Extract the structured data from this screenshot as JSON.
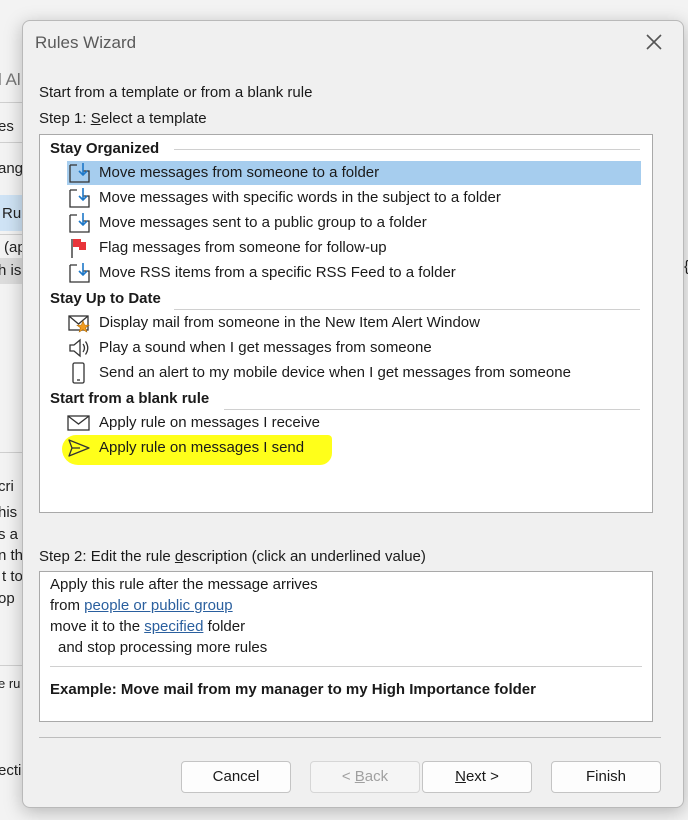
{
  "background": {
    "frag1": "l Al",
    "frag2": "es",
    "frag3": "ang",
    "frag4": "Rul",
    "frag5": "(ap",
    "frag6": "h is",
    "frag7": "cri",
    "frag8": "his",
    "frag9": "s a",
    "frag10": "n th",
    "frag11": "t to",
    "frag12": "op",
    "frag13": "e ru",
    "frag14": "ecti"
  },
  "dialog": {
    "title": "Rules Wizard",
    "intro": "Start from a template or from a blank rule",
    "step1": {
      "prefix": "Step 1: ",
      "accel": "S",
      "rest": "elect a template"
    },
    "groups": [
      {
        "header": "Stay Organized",
        "items": [
          {
            "label": "Move messages from someone to a folder",
            "icon": "move-folder-icon",
            "selected": true
          },
          {
            "label": "Move messages with specific words in the subject to a folder",
            "icon": "move-folder-icon",
            "selected": false
          },
          {
            "label": "Move messages sent to a public group to a folder",
            "icon": "move-folder-icon",
            "selected": false
          },
          {
            "label": "Flag messages from someone for follow-up",
            "icon": "flag-icon",
            "selected": false
          },
          {
            "label": "Move RSS items from a specific RSS Feed to a folder",
            "icon": "move-folder-icon",
            "selected": false
          }
        ]
      },
      {
        "header": "Stay Up to Date",
        "items": [
          {
            "label": "Display mail from someone in the New Item Alert Window",
            "icon": "mail-alert-icon",
            "selected": false
          },
          {
            "label": "Play a sound when I get messages from someone",
            "icon": "speaker-icon",
            "selected": false
          },
          {
            "label": "Send an alert to my mobile device when I get messages from someone",
            "icon": "mobile-device-icon",
            "selected": false
          }
        ]
      },
      {
        "header": "Start from a blank rule",
        "items": [
          {
            "label": "Apply rule on messages I receive",
            "icon": "envelope-icon",
            "selected": false
          },
          {
            "label": "Apply rule on messages I send",
            "icon": "send-icon",
            "selected": false,
            "highlighted": true
          }
        ]
      }
    ],
    "step2": {
      "prefix": "Step 2: Edit the rule ",
      "accel": "d",
      "rest": "escription (click an underlined value)"
    },
    "description": {
      "line1": "Apply this rule after the message arrives",
      "line2_prefix": "from ",
      "line2_link": "people or public group",
      "line3_prefix": "move it to the ",
      "line3_link": "specified",
      "line3_suffix": " folder",
      "line4": "and stop processing more rules",
      "example": "Example: Move mail from my manager to my High Importance folder"
    },
    "buttons": {
      "cancel": "Cancel",
      "back_prefix": "< ",
      "back_accel": "B",
      "back_rest": "ack",
      "next_accel": "N",
      "next_rest": "ext >",
      "finish": "Finish"
    },
    "colors": {
      "selection": "#a6cdee",
      "highlight": "#ffff1a",
      "link": "#2a5f9e"
    }
  }
}
